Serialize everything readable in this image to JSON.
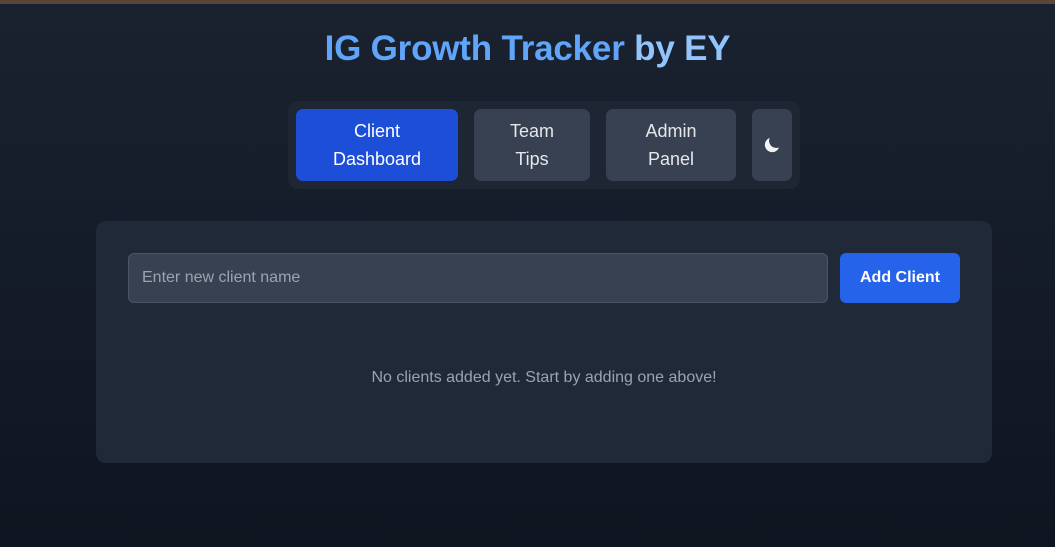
{
  "header": {
    "title_primary": "IG Growth Tracker",
    "title_secondary": "by EY"
  },
  "nav": {
    "tabs": [
      {
        "label": "Client\nDashboard",
        "active": true
      },
      {
        "label": "Team\nTips",
        "active": false
      },
      {
        "label": "Admin\nPanel",
        "active": false
      }
    ],
    "theme_toggle_icon": "moon-icon"
  },
  "clients": {
    "input_placeholder": "Enter new client name",
    "input_value": "",
    "add_button_label": "Add Client",
    "empty_message": "No clients added yet. Start by adding one above!"
  },
  "colors": {
    "accent": "#2563eb",
    "active_tab": "#1d4ed8",
    "title_primary": "#60a5fa",
    "title_secondary": "#93c5fd"
  }
}
